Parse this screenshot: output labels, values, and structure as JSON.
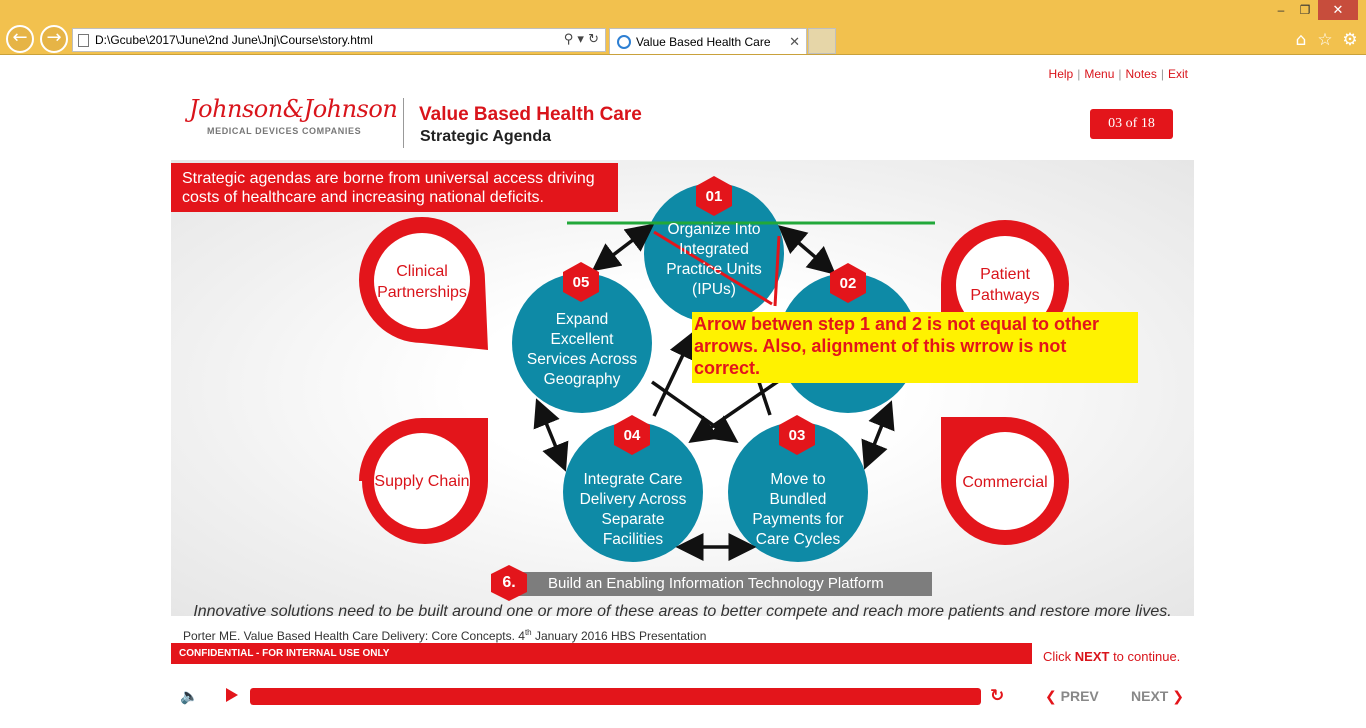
{
  "browser": {
    "address": "D:\\Gcube\\2017\\June\\2nd June\\Jnj\\Course\\story.html",
    "tab_title": "Value Based Health Care"
  },
  "top_links": [
    "Help",
    "Menu",
    "Notes",
    "Exit"
  ],
  "header": {
    "logo_script": "Johnson&Johnson",
    "logo_sub": "MEDICAL DEVICES COMPANIES",
    "title": "Value Based Health Care",
    "subtitle": "Strategic Agenda",
    "page_counter": "03 of 18"
  },
  "intro_text": "Strategic agendas are borne from universal access driving costs of healthcare and increasing national deficits.",
  "steps": [
    {
      "num": "01",
      "lines": [
        "Organize Into",
        "Integrated",
        "Practice Units",
        "(IPUs)"
      ]
    },
    {
      "num": "02",
      "lines": [
        ""
      ]
    },
    {
      "num": "03",
      "lines": [
        "Move to",
        "Bundled",
        "Payments for",
        "Care Cycles"
      ]
    },
    {
      "num": "04",
      "lines": [
        "Integrate Care",
        "Delivery Across",
        "Separate",
        "Facilities"
      ]
    },
    {
      "num": "05",
      "lines": [
        "Expand",
        "Excellent",
        "Services Across",
        "Geography"
      ]
    }
  ],
  "side_items": {
    "clinical": [
      "Clinical",
      "Partnerships"
    ],
    "patient": [
      "Patient",
      "Pathways"
    ],
    "supply": [
      "Supply Chain"
    ],
    "commercial": [
      "Commercial"
    ]
  },
  "platform": {
    "num": "6.",
    "label": "Build an Enabling Information Technology Platform"
  },
  "tagline": "Innovative solutions need to be built around one or more of these areas to better compete and reach more patients and restore more lives.",
  "reference": {
    "pre": "Porter ME. Value Based Health Care Delivery: Core Concepts. 4",
    "sup": "th",
    "post": " January 2016 HBS Presentation"
  },
  "confidential": "CONFIDENTIAL - FOR INTERNAL USE ONLY",
  "click_next": {
    "pre": "Click ",
    "bold": "NEXT",
    "post": " to continue."
  },
  "annotation": "Arrow betwen step 1 and 2 is not equal to other arrows. Also, alignment of this wrrow is not correct.",
  "player": {
    "prev": "PREV",
    "next": "NEXT",
    "progress": 1.0
  },
  "colors": {
    "brand_red": "#e3151b",
    "teal": "#0e8aa6",
    "chrome": "#f2c14e",
    "annotation": "#fff200"
  }
}
